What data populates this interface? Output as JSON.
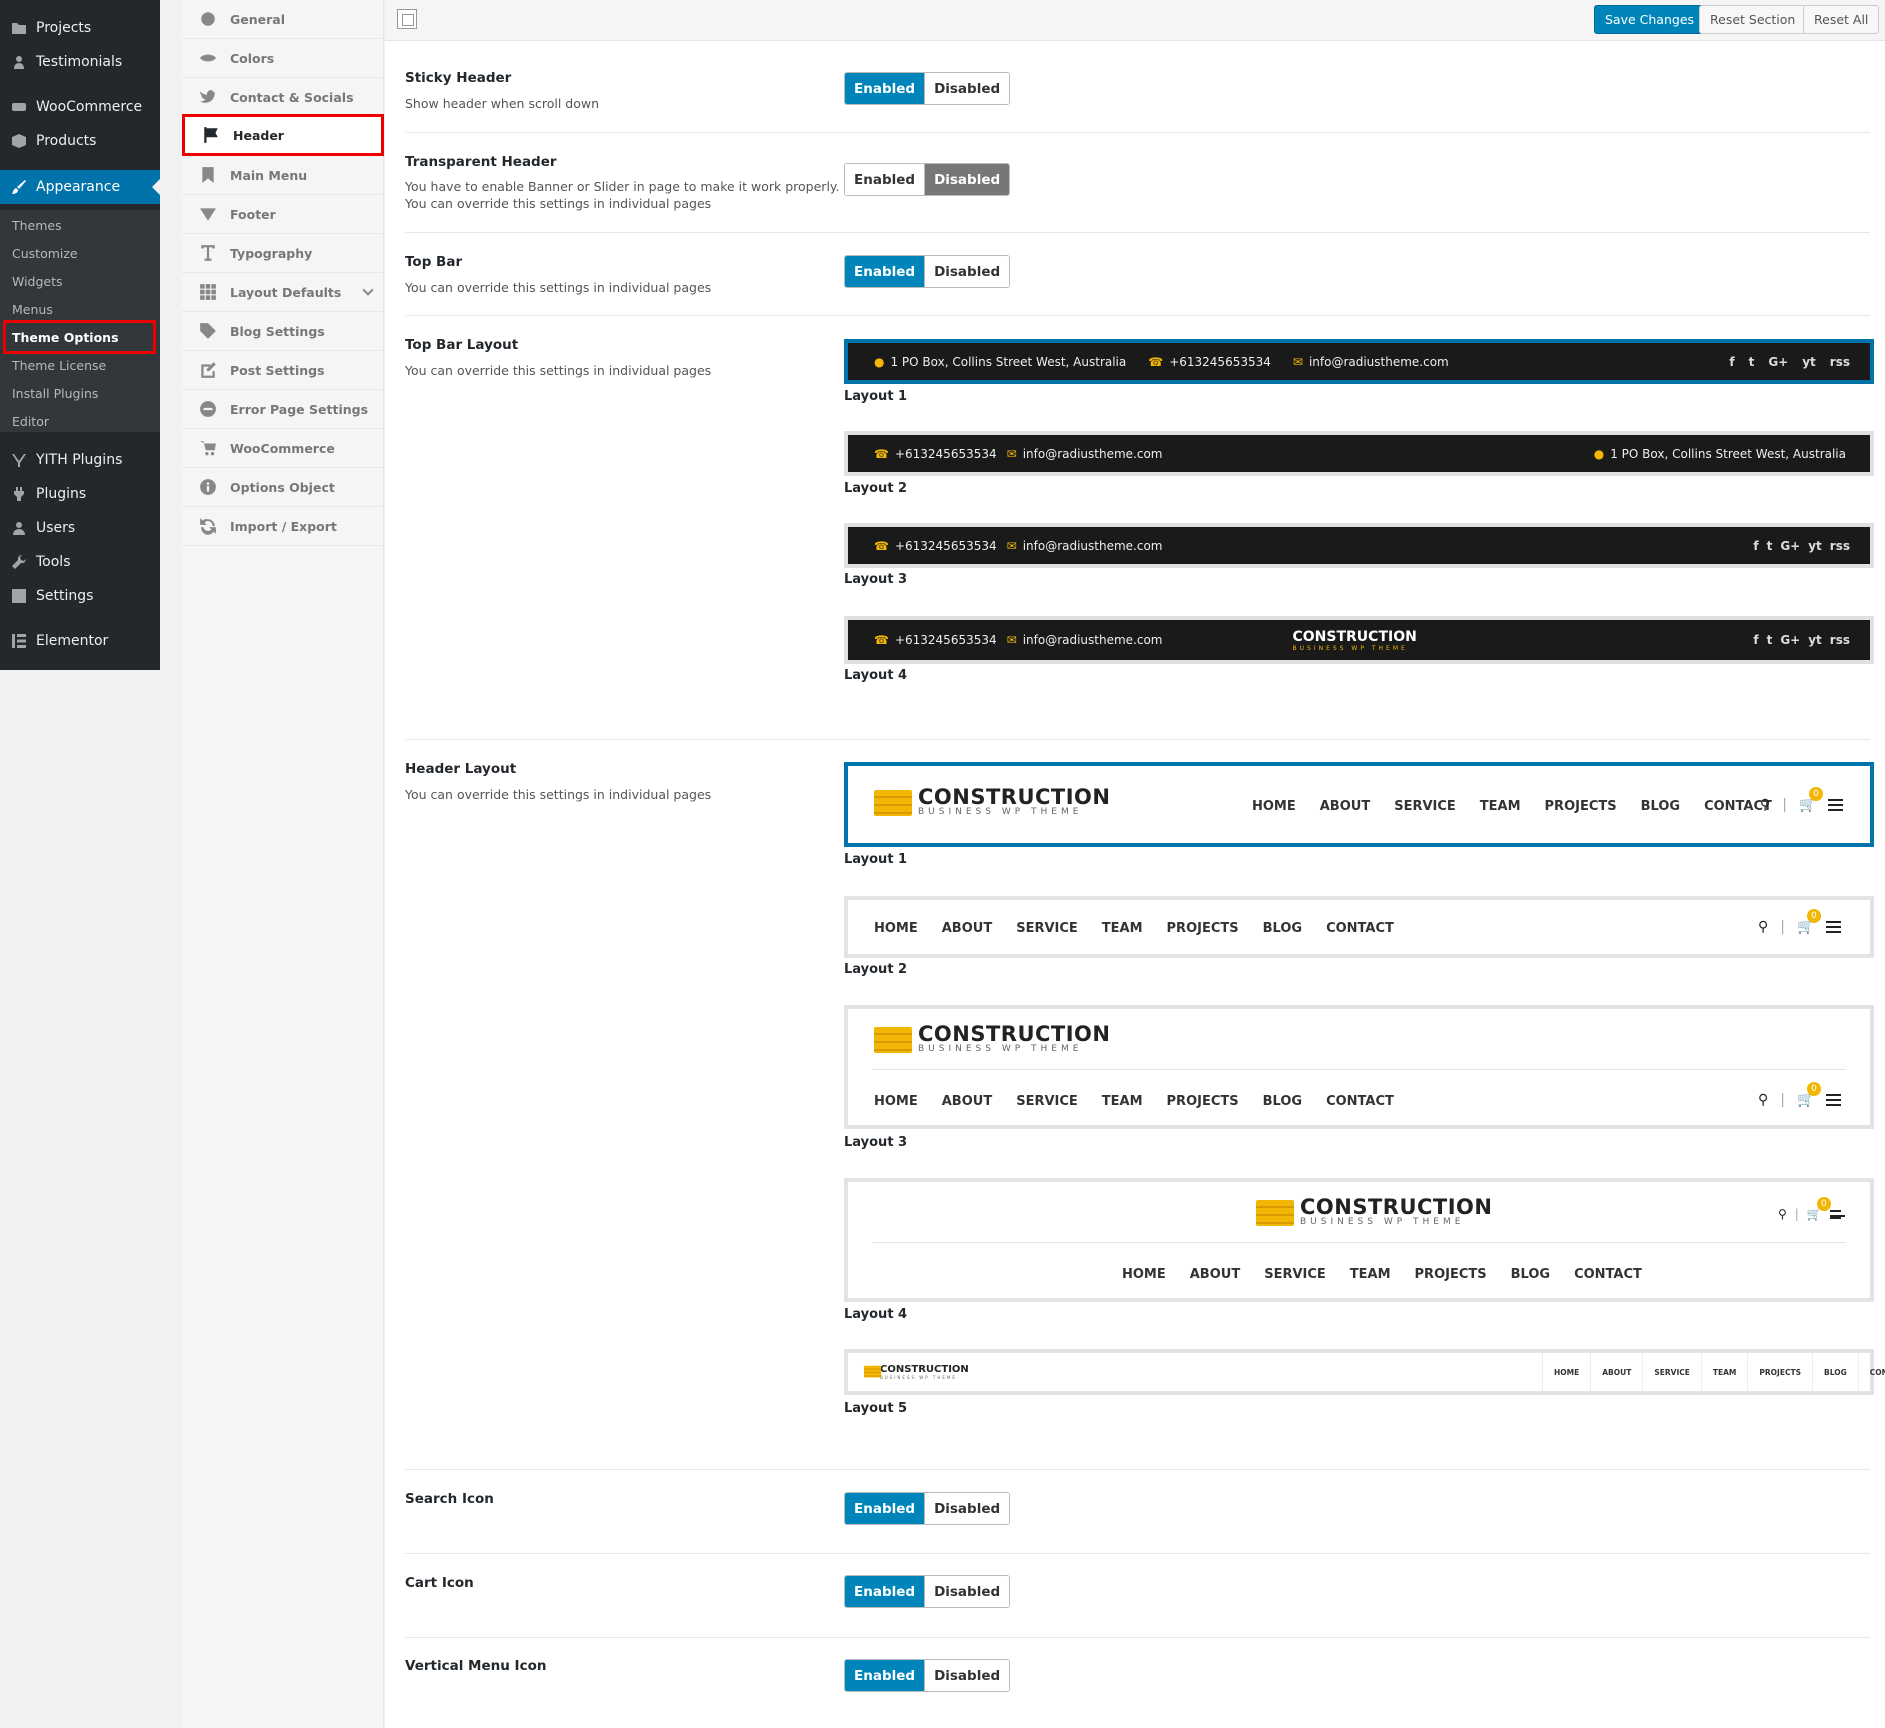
{
  "wp_menu": {
    "items": [
      {
        "label": "Projects",
        "icon": "folder-icon"
      },
      {
        "label": "Testimonials",
        "icon": "user-icon"
      },
      {
        "label": "WooCommerce",
        "icon": "woo-icon"
      },
      {
        "label": "Products",
        "icon": "box-icon"
      },
      {
        "label": "Appearance",
        "icon": "brush-icon"
      },
      {
        "label": "YITH Plugins",
        "icon": "yith-icon"
      },
      {
        "label": "Plugins",
        "icon": "plug-icon"
      },
      {
        "label": "Users",
        "icon": "users-icon"
      },
      {
        "label": "Tools",
        "icon": "wrench-icon"
      },
      {
        "label": "Settings",
        "icon": "sliders-icon"
      },
      {
        "label": "Elementor",
        "icon": "elementor-icon"
      }
    ],
    "sub_items": [
      "Themes",
      "Customize",
      "Widgets",
      "Menus",
      "Theme Options",
      "Theme License",
      "Install Plugins",
      "Editor"
    ]
  },
  "options_nav": [
    {
      "label": "General"
    },
    {
      "label": "Colors"
    },
    {
      "label": "Contact & Socials"
    },
    {
      "label": "Header"
    },
    {
      "label": "Main Menu"
    },
    {
      "label": "Footer"
    },
    {
      "label": "Typography"
    },
    {
      "label": "Layout Defaults"
    },
    {
      "label": "Blog Settings"
    },
    {
      "label": "Post Settings"
    },
    {
      "label": "Error Page Settings"
    },
    {
      "label": "WooCommerce"
    },
    {
      "label": "Options Object"
    },
    {
      "label": "Import / Export"
    }
  ],
  "toolbar": {
    "save": "Save Changes",
    "reset_section": "Reset Section",
    "reset_all": "Reset All"
  },
  "toggle": {
    "enabled": "Enabled",
    "disabled": "Disabled"
  },
  "settings": {
    "sticky": {
      "title": "Sticky Header",
      "desc": "Show header when scroll down"
    },
    "transparent": {
      "title": "Transparent Header",
      "desc1": "You have to enable Banner or Slider in page to make it work properly.",
      "desc2": "You can override this settings in individual pages"
    },
    "topbar": {
      "title": "Top Bar",
      "desc": "You can override this settings in individual pages"
    },
    "topbar_layout": {
      "title": "Top Bar Layout",
      "desc": "You can override this settings in individual pages"
    },
    "header_layout": {
      "title": "Header Layout",
      "desc": "You can override this settings in individual pages"
    },
    "search": {
      "title": "Search Icon"
    },
    "cart": {
      "title": "Cart Icon"
    },
    "vertical": {
      "title": "Vertical Menu Icon"
    }
  },
  "layouts": [
    "Layout 1",
    "Layout 2",
    "Layout 3",
    "Layout 4",
    "Layout 5"
  ],
  "contact": {
    "address": "1 PO Box, Collins Street West, Australia",
    "phone": "+613245653534",
    "email": "info@radiustheme.com"
  },
  "socials": [
    "f",
    "t",
    "G+",
    "yt",
    "rss"
  ],
  "logo": {
    "name": "CONSTRUCTION",
    "tagline": "BUSINESS WP THEME"
  },
  "nav": [
    "HOME",
    "ABOUT",
    "SERVICE",
    "TEAM",
    "PROJECTS",
    "BLOG",
    "CONTACT"
  ],
  "cart_count": "0"
}
